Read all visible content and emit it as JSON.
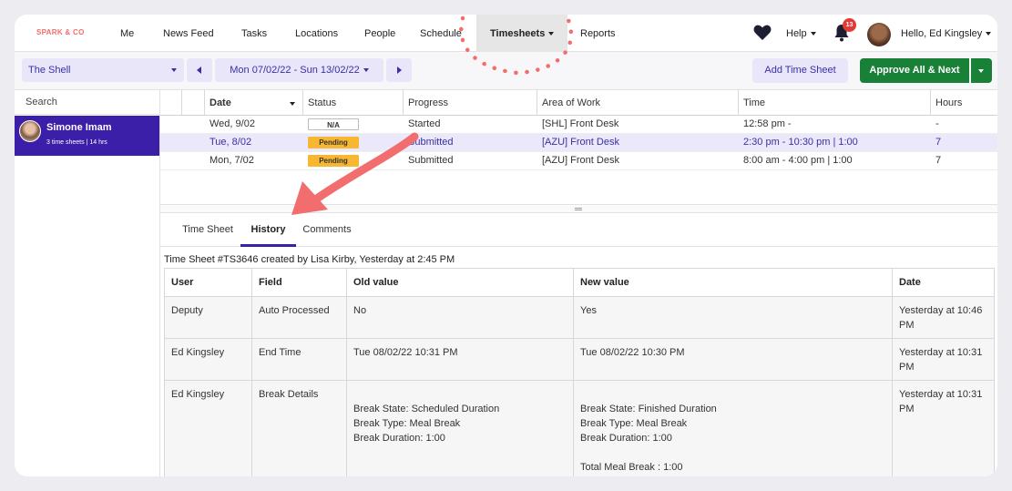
{
  "brand": {
    "logo": "SPARK & CO"
  },
  "nav": {
    "items": [
      "Me",
      "News Feed",
      "Tasks",
      "Locations",
      "People",
      "Schedule"
    ],
    "active": "Timesheets",
    "reports": "Reports",
    "help": "Help",
    "notification_count": "13",
    "greeting": "Hello, Ed Kingsley"
  },
  "toolbar": {
    "location": "The Shell",
    "date_range": "Mon 07/02/22 - Sun 13/02/22",
    "add_timesheet": "Add Time Sheet",
    "approve": "Approve All & Next"
  },
  "sidebar": {
    "search_placeholder": "Search",
    "person": {
      "name": "Simone Imam",
      "summary": "3 time sheets | 14 hrs"
    }
  },
  "timesheets": {
    "columns": [
      "Date",
      "Status",
      "Progress",
      "Area of Work",
      "Time",
      "Hours"
    ],
    "rows": [
      {
        "date": "Wed, 9/02",
        "status": "N/A",
        "progress": "Started",
        "area": "[SHL] Front Desk",
        "time": "12:58 pm -",
        "hours": "-"
      },
      {
        "date": "Tue, 8/02",
        "status": "Pending",
        "progress": "Submitted",
        "area": "[AZU] Front Desk",
        "time": "2:30 pm - 10:30 pm | 1:00",
        "hours": "7"
      },
      {
        "date": "Mon, 7/02",
        "status": "Pending",
        "progress": "Submitted",
        "area": "[AZU] Front Desk",
        "time": "8:00 am - 4:00 pm | 1:00",
        "hours": "7"
      }
    ]
  },
  "tabs": [
    "Time Sheet",
    "History",
    "Comments"
  ],
  "history": {
    "meta": "Time Sheet #TS3646  created by Lisa Kirby, Yesterday at 2:45 PM",
    "columns": [
      "User",
      "Field",
      "Old value",
      "New value",
      "Date"
    ],
    "rows": [
      {
        "user": "Deputy",
        "field": "Auto Processed",
        "old": "No",
        "new": "Yes",
        "date": "Yesterday at 10:46\nPM"
      },
      {
        "user": "Ed Kingsley",
        "field": "End Time",
        "old": "Tue 08/02/22 10:31 PM",
        "new": "Tue 08/02/22 10:30 PM",
        "date": "Yesterday at 10:31\nPM"
      },
      {
        "user": "Ed Kingsley",
        "field": "Break Details",
        "old": "\nBreak State: Scheduled Duration\nBreak Type: Meal Break\nBreak Duration: 1:00",
        "new": "\nBreak State: Finished Duration\nBreak Type: Meal Break\nBreak Duration: 1:00\n\nTotal Meal Break : 1:00",
        "date": "Yesterday at 10:31\nPM"
      }
    ]
  },
  "colors": {
    "brand_purple": "#3b1fa8",
    "approve_green": "#188037",
    "pending": "#f7b731",
    "annotation": "#f26d6d"
  },
  "icons": [
    "heart-icon",
    "bell-icon",
    "caret-down-icon",
    "arrow-left-icon",
    "arrow-right-icon"
  ]
}
